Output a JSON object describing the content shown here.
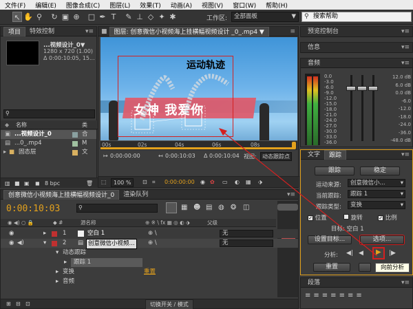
{
  "menu": [
    "文件(F)",
    "编辑(E)",
    "图像合成(C)",
    "图层(L)",
    "效果(T)",
    "动画(A)",
    "视图(V)",
    "窗口(W)",
    "帮助(H)"
  ],
  "toolbar": {
    "workspace_label": "工作区:",
    "workspace_value": "全部面板",
    "search_placeholder": "搜索帮助"
  },
  "project_panel": {
    "tabs": [
      "项目",
      "特效控制"
    ],
    "thumb_title": "...视频设计_0▼",
    "thumb_info1": "1280 x 720 (1.00)",
    "thumb_info2": "Δ 0:00:10:05, 15...",
    "col_name": "名称",
    "col_type": "类",
    "items": [
      {
        "name": "...视频设计_0",
        "type": "合"
      },
      {
        "name": "...0_.mp4",
        "type": "M"
      },
      {
        "name": "固态层",
        "type": "文"
      }
    ],
    "bpc": "8 bpc"
  },
  "viewer": {
    "title": "图层: 创意微信小视频海上挂横幅视频设计 _0_.mp4 ▼",
    "motion_label": "运动轨迹",
    "banner_text": "女神 我爱你",
    "ruler": [
      "00s",
      "02s",
      "04s",
      "06s",
      "08s"
    ],
    "time_start": "0:00:00:00",
    "time_end": "0:00:10:03",
    "time_dur": "Δ 0:00:10:04",
    "view_label": "视图:",
    "view_value": "动态跟踪点",
    "zoom": "100 %",
    "timecode": "0:00:00:00"
  },
  "timeline": {
    "tabs": [
      "创意微信小视频海上挂横幅视频设计_0",
      "渲染队列"
    ],
    "timecode": "0:00:10:03",
    "col_name": "源名称",
    "col_parent": "父级",
    "layers": [
      {
        "num": "1",
        "name": "空白 1",
        "parent": "无",
        "color": "#c03030"
      },
      {
        "num": "2",
        "name": "创意微信小视频...",
        "parent": "无",
        "color": "#c03030"
      }
    ],
    "sub": [
      "动态跟踪",
      "跟踪 1",
      "变换",
      "音频"
    ],
    "reset": "重置",
    "switch_label": "切换开关 / 模式"
  },
  "right": {
    "preview": "预览控制台",
    "info": "信息",
    "audio": "音频",
    "db_values": [
      "0.0",
      "12.0 dB",
      "-3.0",
      "6.0 dB",
      "-6.0",
      "0.0 dB",
      "-9.0",
      "-12.0",
      "-6.0",
      "-15.0",
      "-18.0",
      "-12.0",
      "-21.0",
      "-18.0",
      "-24.0",
      "-24.0",
      "-27.0",
      "-30.0",
      "-33.0",
      "-36.0",
      "-48.0 dB"
    ],
    "db_left": [
      "0.0",
      "-3.0",
      "-6.0",
      "-9.0",
      "-12.0",
      "-15.0",
      "-18.0",
      "-21.0",
      "-24.0",
      "-27.0",
      "-30.0",
      "-33.0",
      "-36.0"
    ],
    "db_right": [
      "12.0 dB",
      "6.0 dB",
      "0.0 dB",
      "-6.0",
      "-12.0",
      "-18.0",
      "-24.0",
      "-36.0",
      "-48.0 dB"
    ],
    "tracker_tabs": [
      "文字",
      "跟踪"
    ],
    "btn_track": "跟踪",
    "btn_stabilize": "稳定",
    "motion_source_label": "运动来源:",
    "motion_source_value": "创意微信小...",
    "current_track_label": "当前跟踪:",
    "current_track_value": "跟踪 1",
    "track_type_label": "跟踪类型:",
    "track_type_value": "变换",
    "check_position": "位置",
    "check_rotation": "旋转",
    "check_scale": "比例",
    "target_label": "目标: 空白 1",
    "btn_set_target": "设置目标...",
    "btn_options": "选项...",
    "analyze_label": "分析:",
    "btn_reset": "重置",
    "tooltip": "向前分析",
    "paragraph": "段落"
  },
  "colors": {
    "accent": "#e3a11c",
    "annotation": "#d42020",
    "banner": "#e05a6a"
  }
}
